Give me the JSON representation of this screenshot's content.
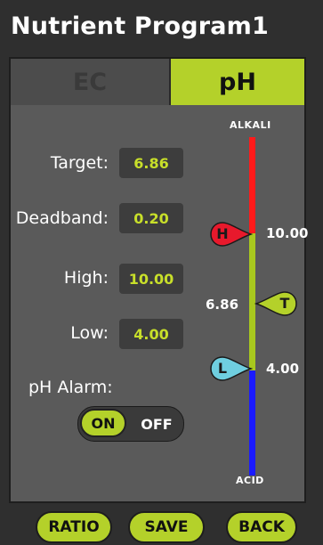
{
  "app": {
    "title": "Nutrient Program1"
  },
  "tabs": [
    {
      "label": "EC",
      "active": false
    },
    {
      "label": "pH",
      "active": true
    }
  ],
  "settings": {
    "target": {
      "label": "Target:",
      "value": "6.86"
    },
    "deadband": {
      "label": "Deadband:",
      "value": "0.20"
    },
    "high": {
      "label": "High:",
      "value": "10.00"
    },
    "low": {
      "label": "Low:",
      "value": "4.00"
    }
  },
  "alarm": {
    "label": "pH Alarm:",
    "on_label": "ON",
    "off_label": "OFF",
    "state": "ON"
  },
  "scale": {
    "top_label": "ALKALI",
    "bottom_label": "ACID",
    "high_marker": {
      "letter": "H",
      "value": "10.00"
    },
    "target_marker": {
      "letter": "T",
      "value": "6.86"
    },
    "low_marker": {
      "letter": "L",
      "value": "4.00"
    }
  },
  "buttons": {
    "ratio": "RATIO",
    "save": "SAVE",
    "back": "BACK"
  },
  "colors": {
    "accent": "#b4d12a",
    "value_text": "#c8df2a",
    "high_bar": "#ff1a1a",
    "mid_bar": "#a8c81e",
    "low_bar": "#1a1aff",
    "high_marker": "#e8192c",
    "low_marker": "#6fcfe0"
  }
}
